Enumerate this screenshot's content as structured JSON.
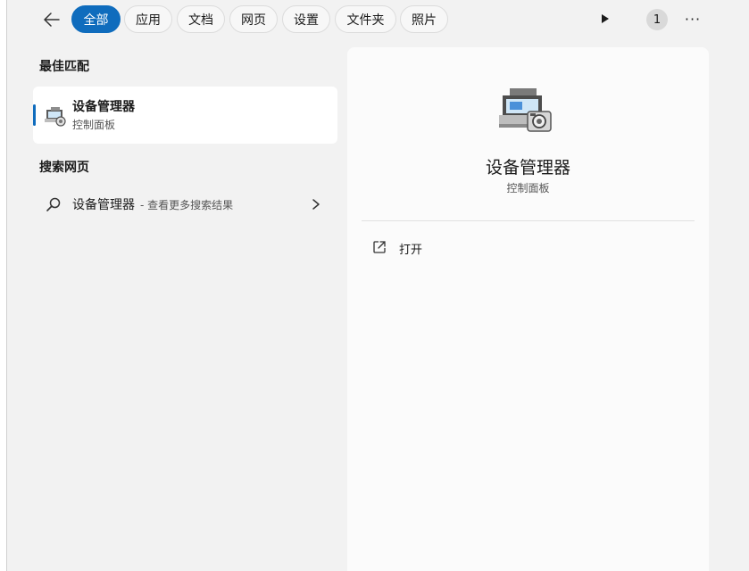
{
  "filters": {
    "back_icon": "arrow-left-icon",
    "tabs": [
      {
        "label": "全部",
        "active": true
      },
      {
        "label": "应用",
        "active": false
      },
      {
        "label": "文档",
        "active": false
      },
      {
        "label": "网页",
        "active": false
      },
      {
        "label": "设置",
        "active": false
      },
      {
        "label": "文件夹",
        "active": false
      },
      {
        "label": "照片",
        "active": false
      }
    ],
    "play_icon": "play-icon",
    "badge_count": "1",
    "more_label": "···"
  },
  "best_match": {
    "section_title": "最佳匹配",
    "name": "设备管理器",
    "category": "控制面板",
    "icon": "device-manager-icon"
  },
  "web_search": {
    "section_title": "搜索网页",
    "query": "设备管理器",
    "hint": " - 查看更多搜索结果",
    "icon": "search-icon"
  },
  "detail": {
    "title": "设备管理器",
    "subtitle": "控制面板",
    "action_label": "打开",
    "action_icon": "open-external-icon"
  },
  "colors": {
    "accent": "#0f6cbd",
    "background": "#f2f2f2",
    "card": "#ffffff"
  }
}
